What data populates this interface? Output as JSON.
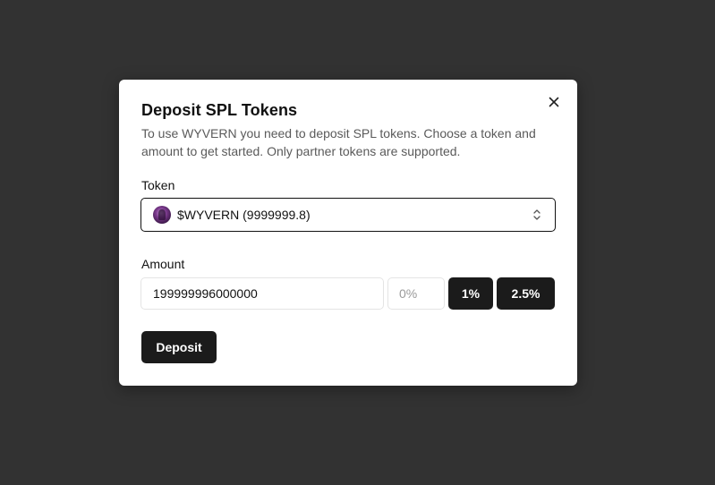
{
  "modal": {
    "title": "Deposit SPL Tokens",
    "description": "To use WYVERN you need to deposit SPL tokens. Choose a token and amount to get started. Only partner tokens are supported.",
    "close_icon": "close-icon"
  },
  "token": {
    "label": "Token",
    "selected": "$WYVERN (9999999.8)",
    "icon": "token-avatar",
    "chevron_icon": "chevron-up-down-icon"
  },
  "amount": {
    "label": "Amount",
    "value": "199999996000000",
    "percent_placeholder": "0%",
    "percent_value": "",
    "preset_1": "1%",
    "preset_2": "2.5%"
  },
  "actions": {
    "deposit_label": "Deposit"
  },
  "colors": {
    "backdrop": "#323232",
    "modal_bg": "#ffffff",
    "button_bg": "#1b1b1b",
    "button_text": "#ffffff"
  }
}
